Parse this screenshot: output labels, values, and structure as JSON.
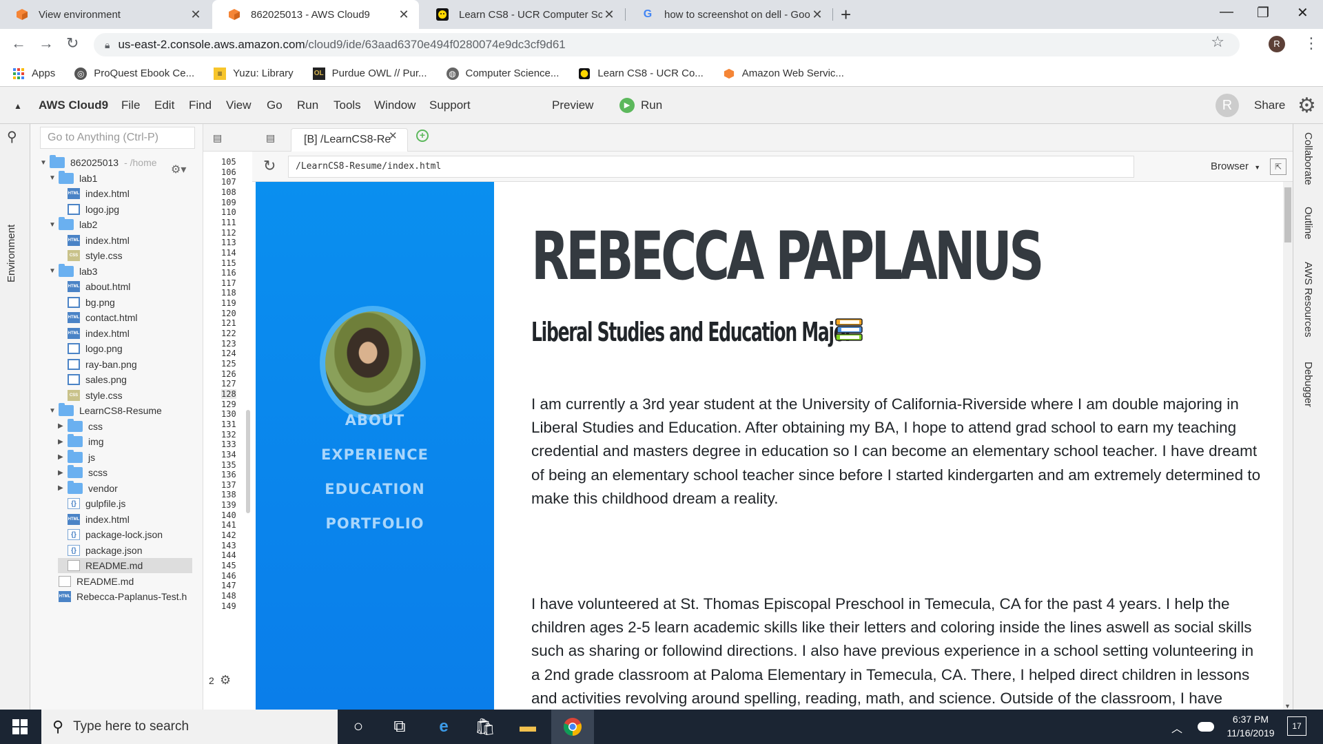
{
  "browser": {
    "tabs": [
      {
        "title": "View environment",
        "icon": "aws-cube-icon",
        "active": false
      },
      {
        "title": "862025013 - AWS Cloud9",
        "icon": "aws-cube-icon",
        "active": true
      },
      {
        "title": "Learn CS8 - UCR Computer Scien",
        "icon": "smiley-icon",
        "active": false
      },
      {
        "title": "how to screenshot on dell - Goo",
        "icon": "google-g-icon",
        "active": false
      }
    ],
    "url_host": "us-east-2.console.aws.amazon.com",
    "url_path": "/cloud9/ide/63aad6370e494f0280074e9dc3cf9d61",
    "profile_initial": "R",
    "bookmarks": [
      {
        "label": "Apps",
        "icon": "apps-grid-icon"
      },
      {
        "label": "ProQuest Ebook Ce...",
        "icon": "proquest-icon"
      },
      {
        "label": "Yuzu: Library",
        "icon": "yuzu-icon"
      },
      {
        "label": "Purdue OWL // Pur...",
        "icon": "owl-icon"
      },
      {
        "label": "Computer Science...",
        "icon": "globe-icon"
      },
      {
        "label": "Learn CS8 - UCR Co...",
        "icon": "smiley-icon"
      },
      {
        "label": "Amazon Web Servic...",
        "icon": "aws-cube-icon"
      }
    ]
  },
  "ide": {
    "brand": "AWS Cloud9",
    "menu": [
      "File",
      "Edit",
      "Find",
      "View",
      "Go",
      "Run",
      "Tools",
      "Window",
      "Support"
    ],
    "preview_label": "Preview",
    "run_label": "Run",
    "share_label": "Share",
    "user_initial": "R",
    "goto_placeholder": "Go to Anything (Ctrl-P)",
    "env_tab": "Environment",
    "right_tabs": [
      "Collaborate",
      "Outline",
      "AWS Resources",
      "Debugger"
    ],
    "tree": [
      {
        "label": "862025013",
        "suffix": "- /home",
        "type": "folder",
        "depth": 0,
        "expanded": true
      },
      {
        "label": "lab1",
        "type": "folder",
        "depth": 1,
        "expanded": true
      },
      {
        "label": "index.html",
        "type": "html",
        "depth": 2
      },
      {
        "label": "logo.jpg",
        "type": "img",
        "depth": 2
      },
      {
        "label": "lab2",
        "type": "folder",
        "depth": 1,
        "expanded": true
      },
      {
        "label": "index.html",
        "type": "html",
        "depth": 2
      },
      {
        "label": "style.css",
        "type": "css",
        "depth": 2
      },
      {
        "label": "lab3",
        "type": "folder",
        "depth": 1,
        "expanded": true
      },
      {
        "label": "about.html",
        "type": "html",
        "depth": 2
      },
      {
        "label": "bg.png",
        "type": "img",
        "depth": 2
      },
      {
        "label": "contact.html",
        "type": "html",
        "depth": 2
      },
      {
        "label": "index.html",
        "type": "html",
        "depth": 2
      },
      {
        "label": "logo.png",
        "type": "img",
        "depth": 2
      },
      {
        "label": "ray-ban.png",
        "type": "img",
        "depth": 2
      },
      {
        "label": "sales.png",
        "type": "img",
        "depth": 2
      },
      {
        "label": "style.css",
        "type": "css",
        "depth": 2
      },
      {
        "label": "LearnCS8-Resume",
        "type": "folder",
        "depth": 1,
        "expanded": true
      },
      {
        "label": "css",
        "type": "folder",
        "depth": 2,
        "expanded": false
      },
      {
        "label": "img",
        "type": "folder",
        "depth": 2,
        "expanded": false
      },
      {
        "label": "js",
        "type": "folder",
        "depth": 2,
        "expanded": false
      },
      {
        "label": "scss",
        "type": "folder",
        "depth": 2,
        "expanded": false
      },
      {
        "label": "vendor",
        "type": "folder",
        "depth": 2,
        "expanded": false
      },
      {
        "label": "gulpfile.js",
        "type": "js",
        "depth": 2
      },
      {
        "label": "index.html",
        "type": "html",
        "depth": 2
      },
      {
        "label": "package-lock.json",
        "type": "js",
        "depth": 2
      },
      {
        "label": "package.json",
        "type": "js",
        "depth": 2
      },
      {
        "label": "README.md",
        "type": "md",
        "depth": 2,
        "selected": true
      },
      {
        "label": "README.md",
        "type": "md",
        "depth": 1
      },
      {
        "label": "Rebecca-Paplanus-Test.h",
        "type": "html",
        "depth": 1
      }
    ],
    "gutter_tab_letter": "b",
    "line_numbers": [
      "105",
      "106",
      "107",
      "108",
      "109",
      "110",
      "111",
      "112",
      "113",
      "114",
      "115",
      "116",
      "117",
      "118",
      "119",
      "120",
      "121",
      "122",
      "123",
      "124",
      "125",
      "126",
      "127",
      "128",
      "129",
      "130",
      "131",
      "132",
      "133",
      "134",
      "135",
      "136",
      "137",
      "138",
      "139",
      "140",
      "141",
      "142",
      "143",
      "144",
      "145",
      "146",
      "147",
      "148",
      "149"
    ],
    "highlighted_line": "128",
    "gutter_badge": "2",
    "preview_tab": "[B] /LearnCS8-Re",
    "preview_url": "/LearnCS8-Resume/index.html",
    "browser_select": "Browser"
  },
  "resume": {
    "nav": [
      "ABOUT",
      "EXPERIENCE",
      "EDUCATION",
      "PORTFOLIO"
    ],
    "name": "REBECCA PAPLANUS",
    "subtitle": "Liberal Studies and Education Major",
    "paragraph1": "I am currently a 3rd year student at the University of California-Riverside where I am double majoring in Liberal Studies and Education. After obtaining my BA, I hope to attend grad school to earn my teaching credential and masters degree in education so I can become an elementary school teacher. I have dreamt of being an elementary school teacher since before I started kindergarten and am extremely determined to make this childhood dream a reality.",
    "paragraph2": "I have volunteered at St. Thomas Episcopal Preschool in Temecula, CA for the past 4 years. I help the children ages 2-5 learn academic skills like their letters and coloring inside the lines aswell as social skills such as sharing or followind directions. I also have previous experience in a school setting volunteering in a 2nd grade classroom at Paloma Elementary in Temecula, CA. There, I helped direct children in lessons and activities revolving around spelling, reading, math, and science. Outside of the classroom, I have further practice working with children as a member of Project Sunshine in Riverside, CA. For a year now, I have visited children of various ages in the pediatric unit, playing games, making crafts, or simply talking with them while they are in the"
  },
  "taskbar": {
    "search_placeholder": "Type here to search",
    "time": "6:37 PM",
    "date": "11/16/2019",
    "notification_count": "17"
  },
  "colors": {
    "sidebar_blue": "#0a8fef",
    "nav_text": "#a9d6fb",
    "run_green": "#5cb85c"
  }
}
